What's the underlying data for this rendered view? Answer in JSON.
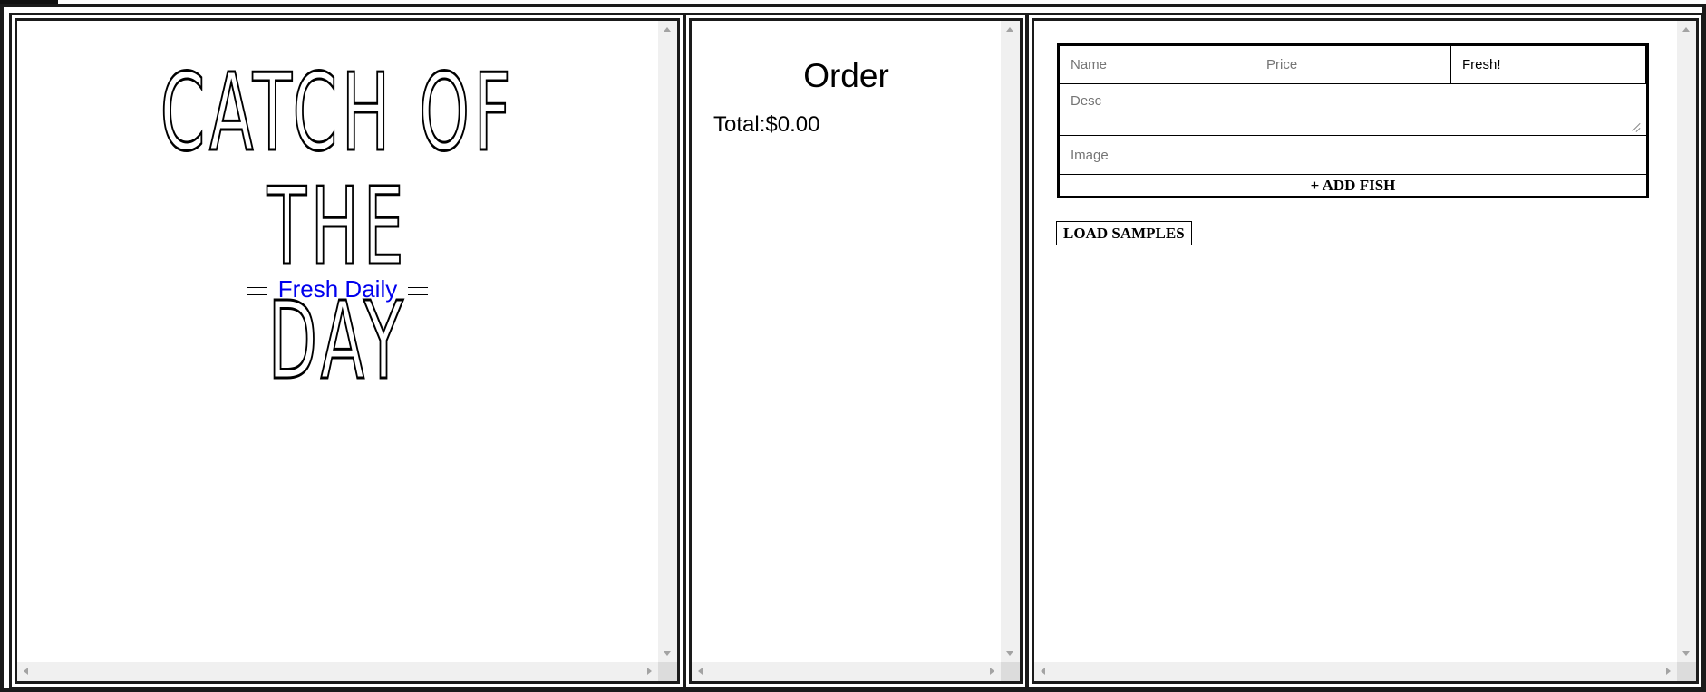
{
  "menu": {
    "title_lines": [
      "CATCH OF THE",
      "DAY"
    ],
    "tagline": "Fresh Daily",
    "tagline_color": "#0000ee"
  },
  "order": {
    "title": "Order",
    "total_label": "Total:",
    "total_value": "$0.00"
  },
  "inventory": {
    "form": {
      "name_placeholder": "Name",
      "price_placeholder": "Price",
      "status_value": "Fresh!",
      "desc_placeholder": "Desc",
      "image_placeholder": "Image",
      "add_button_label": "+ ADD FISH"
    },
    "load_samples_label": "LOAD SAMPLES"
  },
  "scrollbars": {
    "arrows": [
      "scroll-up-arrow",
      "scroll-down-arrow",
      "scroll-left-arrow",
      "scroll-right-arrow"
    ]
  }
}
